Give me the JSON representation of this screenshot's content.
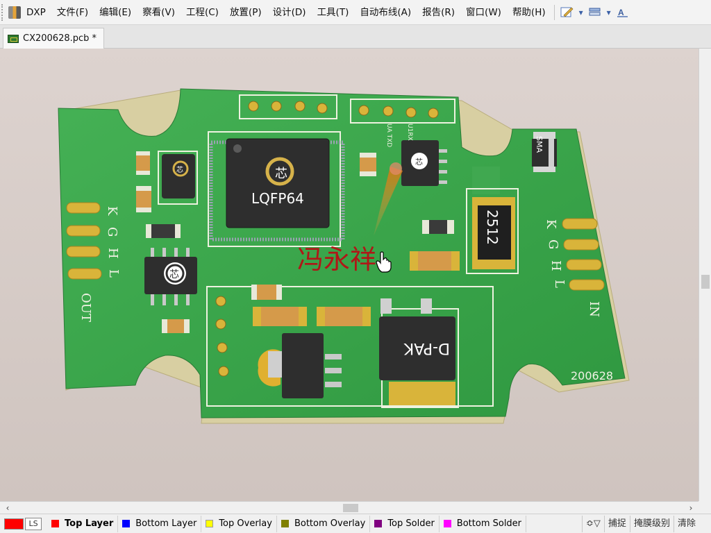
{
  "app": {
    "logo_text": "DXP",
    "menu": [
      "文件(F)",
      "编辑(E)",
      "察看(V)",
      "工程(C)",
      "放置(P)",
      "设计(D)",
      "工具(T)",
      "自动布线(A)",
      "报告(R)",
      "窗口(W)",
      "帮助(H)"
    ]
  },
  "toolbar": {
    "buttons": [
      "edit-tool-icon",
      "layer-stack-icon",
      "text-style-icon"
    ]
  },
  "document_tab": {
    "title": "CX200628.pcb *"
  },
  "pcb": {
    "silkscreen": {
      "mcu_package": "LQFP64",
      "board_id": "200628",
      "resistor_value": "2512",
      "diode_package": "SMA",
      "regulator_package": "D-PAK",
      "logo_char": "芯",
      "left_labels": [
        "K",
        "G",
        "H",
        "L"
      ],
      "left_port": "OUT",
      "right_labels": [
        "K",
        "G",
        "H",
        "L"
      ],
      "right_port": "IN",
      "uart_tx": "UA TXD",
      "uart_rx": "U1RX"
    },
    "author_overlay": "冯永祥",
    "colors": {
      "board": "#39a64a",
      "board_edge": "#d9cfa0",
      "silk": "#f0f2e4",
      "pad": "#d9b43a",
      "ic_body": "#2d2d2d",
      "author_text": "#b01717"
    }
  },
  "layers": {
    "current_label": "LS",
    "current_color": "#ff0000",
    "items": [
      {
        "name": "Top Layer",
        "color": "#ff0000",
        "active": true
      },
      {
        "name": "Bottom Layer",
        "color": "#0000ff",
        "active": false
      },
      {
        "name": "Top Overlay",
        "color": "#ffff00",
        "active": false
      },
      {
        "name": "Bottom Overlay",
        "color": "#808000",
        "active": false
      },
      {
        "name": "Top Solder",
        "color": "#800080",
        "active": false
      },
      {
        "name": "Bottom Solder",
        "color": "#ff00ff",
        "active": false
      }
    ],
    "tools": {
      "snap": "捕捉",
      "mask_level": "掩膜级别",
      "clear": "清除"
    }
  }
}
